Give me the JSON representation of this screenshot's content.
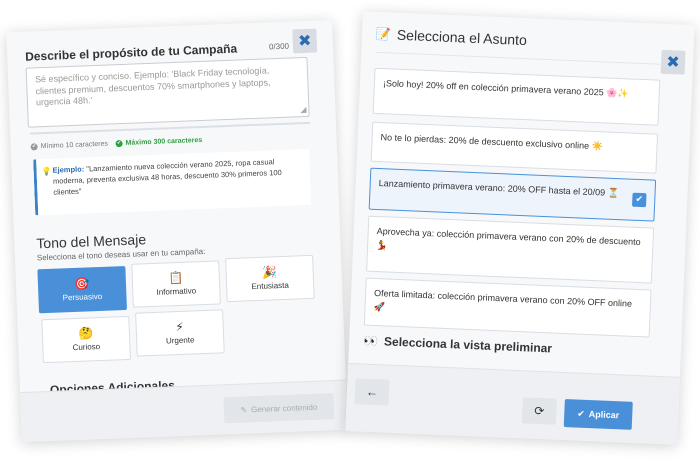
{
  "left": {
    "title": "Describe el propósito de tu Campaña",
    "counter": "0/300",
    "close_icon": "✖",
    "textarea_placeholder": "Sé específico y conciso. Ejemplo: 'Black Friday tecnología, clientes premium, descuentos 70% smartphones y laptops, urgencia 48h.'",
    "progress_percent": 0,
    "hint_min": "Mínimo 10 caracteres",
    "hint_max": "Máximo 300 caracteres",
    "example_label": "Ejemplo:",
    "example_text": "\"Lanzamiento nueva colección verano 2025, ropa casual moderna, preventa exclusiva 48 horas, descuento 30% primeros 100 clientes\"",
    "tone_title": "Tono del Mensaje",
    "tone_subtitle": "Selecciona el tono deseas usar en tu campaña:",
    "tones": [
      {
        "label": "Persuasivo",
        "icon": "🎯",
        "active": true
      },
      {
        "label": "Informativo",
        "icon": "📋",
        "active": false
      },
      {
        "label": "Entusiasta",
        "icon": "🎉",
        "active": false
      },
      {
        "label": "Curioso",
        "icon": "🤔",
        "active": false
      },
      {
        "label": "Urgente",
        "icon": "⚡",
        "active": false
      }
    ],
    "options_title": "Opciones Adicionales",
    "generate_icon": "✎",
    "generate_label": "Generar contenido"
  },
  "right": {
    "title_icon": "📝",
    "title": "Selecciona el Asunto",
    "close_icon": "✖",
    "subjects": [
      {
        "text": "¡Solo hoy! 20% off en colección primavera verano 2025 🌸✨",
        "selected": false
      },
      {
        "text": "No te lo pierdas: 20% de descuento exclusivo online ☀️",
        "selected": false
      },
      {
        "text": "Lanzamiento primavera verano: 20% OFF hasta el 20/09 ⏳",
        "selected": true
      },
      {
        "text": "Aprovecha ya: colección primavera verano con 20% de descuento 💃",
        "selected": false
      },
      {
        "text": "Oferta limitada: colección primavera verano con 20% OFF online 🚀",
        "selected": false
      }
    ],
    "check_icon": "✔",
    "preview_icon": "👀",
    "preview_title": "Selecciona la vista preliminar",
    "back_icon": "←",
    "refresh_icon": "⟳",
    "apply_icon": "✔",
    "apply_label": "Aplicar"
  }
}
